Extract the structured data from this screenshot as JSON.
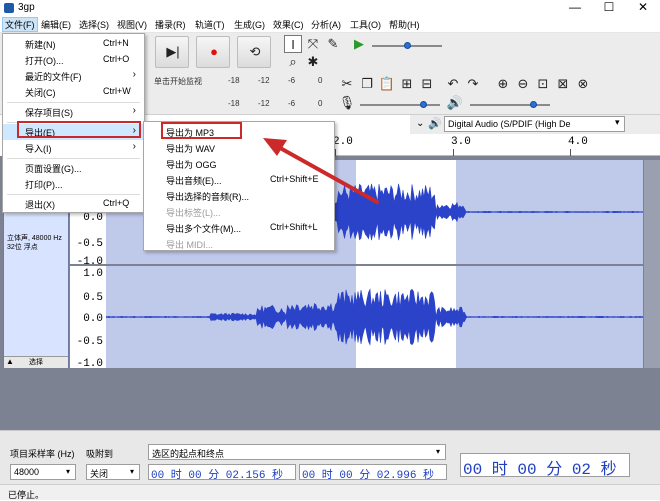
{
  "window": {
    "title": "3gp",
    "minimize": "—",
    "maximize": "☐",
    "close": "✕"
  },
  "menubar": [
    "文件(F)",
    "编辑(E)",
    "选择(S)",
    "视图(V)",
    "播录(R)",
    "轨道(T)",
    "生成(G)",
    "效果(C)",
    "分析(A)",
    "工具(O)",
    "帮助(H)"
  ],
  "file_menu": [
    {
      "label": "新建(N)",
      "shortcut": "Ctrl+N"
    },
    {
      "label": "打开(O)...",
      "shortcut": "Ctrl+O"
    },
    {
      "label": "最近的文件(F)",
      "shortcut": "",
      "submenu": true
    },
    {
      "label": "关闭(C)",
      "shortcut": "Ctrl+W"
    },
    {
      "label": "保存项目(S)",
      "shortcut": "",
      "submenu": true
    },
    {
      "label": "导出(E)",
      "shortcut": "",
      "submenu": true
    },
    {
      "label": "导入(I)",
      "shortcut": "",
      "submenu": true
    },
    {
      "label": "页面设置(G)...",
      "shortcut": ""
    },
    {
      "label": "打印(P)...",
      "shortcut": ""
    },
    {
      "label": "退出(X)",
      "shortcut": "Ctrl+Q"
    }
  ],
  "export_menu": [
    {
      "label": "导出为 MP3",
      "shortcut": ""
    },
    {
      "label": "导出为 WAV",
      "shortcut": ""
    },
    {
      "label": "导出为 OGG",
      "shortcut": ""
    },
    {
      "label": "导出音频(E)...",
      "shortcut": "Ctrl+Shift+E"
    },
    {
      "label": "导出选择的音频(R)...",
      "shortcut": ""
    },
    {
      "label": "导出标签(L)...",
      "shortcut": "",
      "disabled": true
    },
    {
      "label": "导出多个文件(M)...",
      "shortcut": "Ctrl+Shift+L"
    },
    {
      "label": "导出 MIDI...",
      "shortcut": "",
      "disabled": true
    }
  ],
  "meter": {
    "hint": "单击开始监视",
    "ticks": [
      "-18",
      "-12",
      "-6",
      "0"
    ]
  },
  "device": {
    "label": "Digital Audio (S/PDIF (High De"
  },
  "ruler": {
    "ticks": [
      "2.0",
      "3.0",
      "4.0"
    ]
  },
  "track": {
    "info1": "立体声, 48000 Hz",
    "info2": "32位 浮点",
    "select_btn": "选择",
    "scale": [
      "1.0",
      "0.5",
      "0.0",
      "-0.5",
      "-1.0"
    ]
  },
  "bottom": {
    "rate_label": "项目采样率 (Hz)",
    "snap_label": "吸附到",
    "rate_value": "48000",
    "snap_value": "关闭",
    "sel_label": "选区的起点和终点",
    "start_time": "00 时 00 分 02.156 秒",
    "end_time": "00 时 00 分 02.996 秒",
    "big_time": "00 时 00 分 02 秒"
  },
  "status": {
    "text": "已停止。"
  },
  "colors": {
    "accent": "#cc2a2a",
    "wave": "#2b43c9",
    "highlight": "#cde8ff"
  }
}
